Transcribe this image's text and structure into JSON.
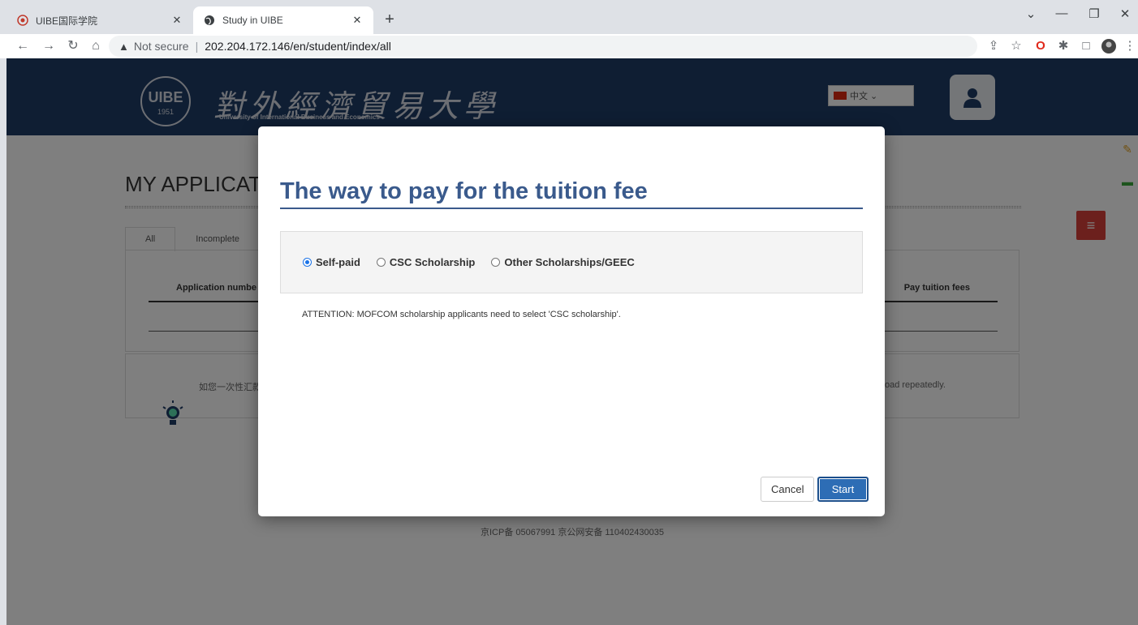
{
  "browser": {
    "tabs": [
      {
        "title": "UIBE国际学院",
        "active": false
      },
      {
        "title": "Study in UIBE",
        "active": true
      }
    ],
    "url_security": "Not secure",
    "url": "202.204.172.146/en/student/index/all"
  },
  "site": {
    "logo_cn": "對外經濟貿易大學",
    "logo_en": "University of International Business and Economics",
    "logo_seal_text": "UIBE",
    "logo_year": "1951",
    "language": "中文"
  },
  "background_page": {
    "title": "MY APPLICAT",
    "tabs": [
      "All",
      "Incomplete"
    ],
    "table": {
      "col_first": "Application numbe",
      "col_last": "Pay tuition fees"
    },
    "notice_left": "如您一次性汇款",
    "notice_right": "oad repeatedly.",
    "footer": "京ICP备 05067991 京公网安备 110402430035"
  },
  "modal": {
    "title": "The way to pay for the tuition fee",
    "options": [
      {
        "label": "Self-paid",
        "checked": true
      },
      {
        "label": "CSC Scholarship",
        "checked": false
      },
      {
        "label": "Other Scholarships/GEEC",
        "checked": false
      }
    ],
    "attention": "ATTENTION: MOFCOM scholarship applicants need to select 'CSC scholarship'.",
    "cancel_label": "Cancel",
    "start_label": "Start"
  },
  "colors": {
    "header_bg": "#1f3d66",
    "title_blue": "#3a5a8c",
    "primary_button": "#2d6db5",
    "menu_red": "#d9413a"
  }
}
